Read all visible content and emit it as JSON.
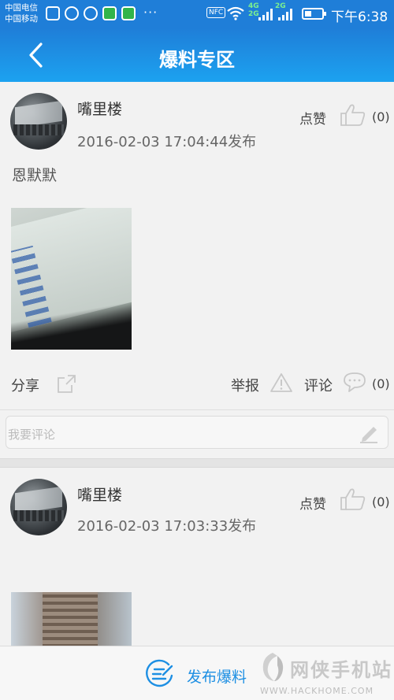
{
  "status_bar": {
    "carrier1": "中国电信",
    "carrier2": "中国移动",
    "more": "···",
    "nfc": "NFC",
    "net1": "4G",
    "net1b": "2G",
    "net2": "2G",
    "time": "下午6:38"
  },
  "header": {
    "title": "爆料专区",
    "back_icon": "chevron-left-icon"
  },
  "posts": [
    {
      "username": "嘴里楼",
      "time": "2016-02-03 17:04:44发布",
      "like_label": "点赞",
      "like_count": "(0)",
      "text": "恩默默",
      "share_label": "分享",
      "report_label": "举报",
      "comment_label": "评论",
      "comment_count": "(0)",
      "comment_placeholder": "我要评论"
    },
    {
      "username": "嘴里楼",
      "time": "2016-02-03 17:03:33发布",
      "like_label": "点赞",
      "like_count": "(0)"
    }
  ],
  "bottom_bar": {
    "publish_label": "发布爆料",
    "watermark_text": "网侠手机站",
    "watermark_url": "WWW.HACKHOME.COM"
  },
  "colors": {
    "header_top": "#1f7ed8",
    "header_bottom": "#1ca2f0",
    "accent": "#1d8fe3"
  }
}
